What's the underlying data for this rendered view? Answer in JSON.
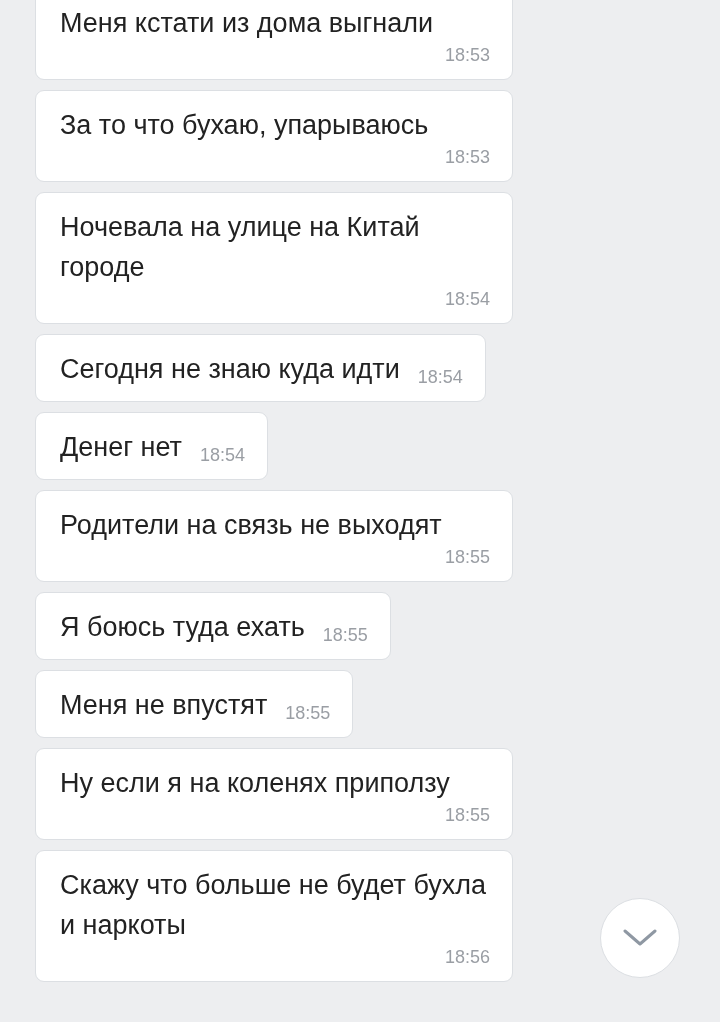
{
  "messages": [
    {
      "text": "Меня кстати из дома выгнали",
      "time": "18:53"
    },
    {
      "text": "За то что бухаю, упарываюсь",
      "time": "18:53"
    },
    {
      "text": "Ночевала на улице на Китай городе",
      "time": "18:54"
    },
    {
      "text": "Сегодня не знаю куда идти",
      "time": "18:54"
    },
    {
      "text": "Денег нет",
      "time": "18:54"
    },
    {
      "text": "Родители на связь не выходят",
      "time": "18:55"
    },
    {
      "text": "Я боюсь туда ехать",
      "time": "18:55"
    },
    {
      "text": "Меня не впустят",
      "time": "18:55"
    },
    {
      "text": "Ну если я на коленях приползу",
      "time": "18:55"
    },
    {
      "text": "Скажу что больше не будет бухла и наркоты",
      "time": "18:56"
    }
  ]
}
